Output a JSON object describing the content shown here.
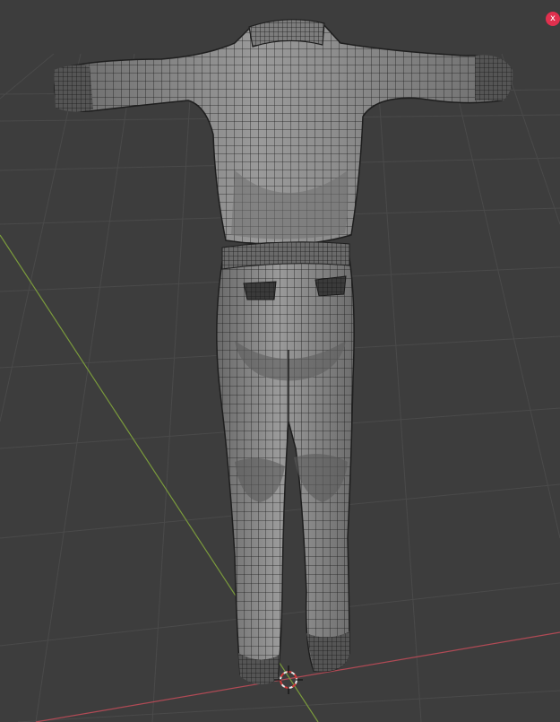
{
  "viewport": {
    "background_color": "#3d3d3d",
    "grid_color": "#4a4a4a",
    "x_axis_color": "#b04a55",
    "y_axis_color": "#7a9a3c",
    "mesh_fill": "#8c8c8c",
    "mesh_shade": "#5e5e5e",
    "wire_color": "#1e1e1e"
  },
  "close_button": {
    "label": "x",
    "color": "#e0304e",
    "icon": "close-icon"
  },
  "model": {
    "name": "shirt-and-pants-mesh",
    "view": "back"
  },
  "cursor_3d": {
    "icon": "3d-cursor-icon",
    "ring_color": "#e8e8e8",
    "dash_color": "#d03a3a"
  }
}
